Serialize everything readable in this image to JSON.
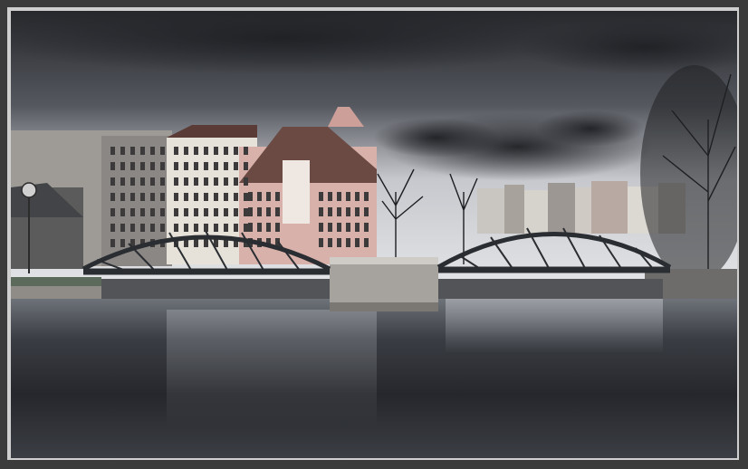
{
  "image": {
    "kind": "photograph",
    "subject": "river-bridges-city",
    "palette": {
      "sky_dark": "#2c2e33",
      "sky_mid": "#5c5f66",
      "sky_light": "#c9cbd0",
      "water_dark": "#17191d",
      "water_light": "#8e9299",
      "building_pink": "#d9b2ad",
      "building_cream": "#e7e2da",
      "building_grey": "#9a9794",
      "bridge_iron": "#2a2d31"
    }
  }
}
